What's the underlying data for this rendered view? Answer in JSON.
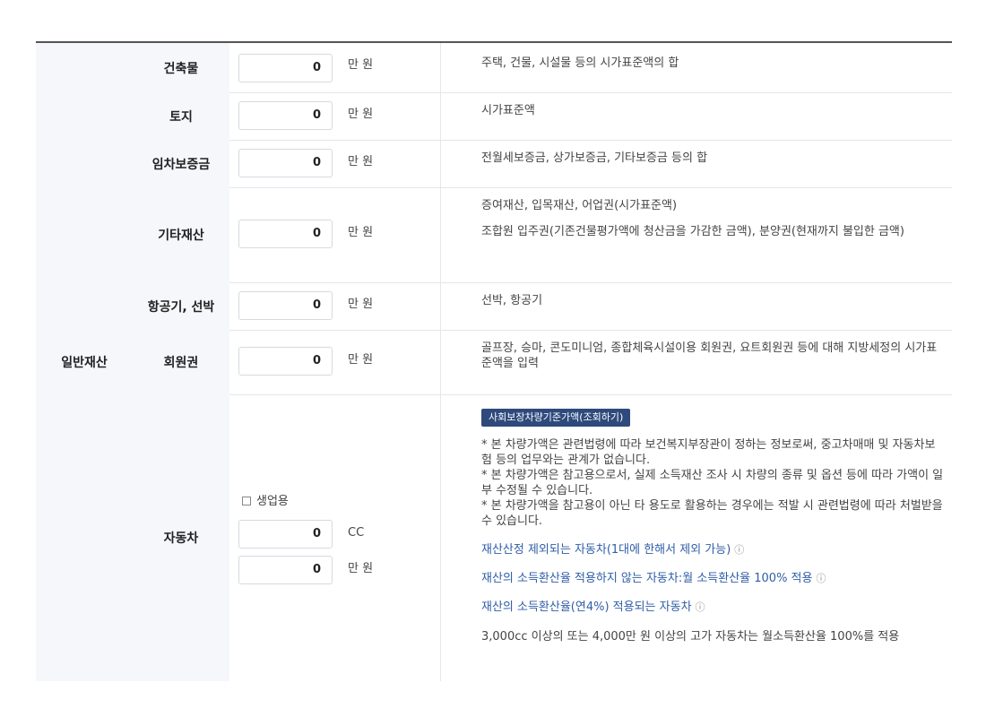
{
  "category": "일반재산",
  "rows": [
    {
      "label": "건축물",
      "value": "0",
      "unit": "만 원",
      "desc": "주택, 건물, 시설물 등의 시가표준액의 합"
    },
    {
      "label": "토지",
      "value": "0",
      "unit": "만 원",
      "desc": "시가표준액"
    },
    {
      "label": "임차보증금",
      "value": "0",
      "unit": "만 원",
      "desc": "전월세보증금, 상가보증금, 기타보증금 등의 합"
    },
    {
      "label": "기타재산",
      "value": "0",
      "unit": "만 원",
      "desc1": "증여재산, 입목재산, 어업권(시가표준액)",
      "desc2": "조합원 입주권(기존건물평가액에 청산금을 가감한 금액), 분양권(현재까지 불입한 금액)"
    },
    {
      "label": "항공기, 선박",
      "value": "0",
      "unit": "만 원",
      "desc": "선박, 항공기"
    },
    {
      "label": "회원권",
      "value": "0",
      "unit": "만 원",
      "desc": "골프장, 승마, 콘도미니엄, 종합체육시설이용 회원권, 요트회원권 등에 대해 지방세정의 시가표준액을 입력"
    }
  ],
  "car": {
    "label": "자동차",
    "checkbox_label": "생업용",
    "cc_value": "0",
    "cc_unit": "CC",
    "price_value": "0",
    "price_unit": "만 원",
    "badge": "사회보장차량기준가액(조회하기)",
    "notes": [
      "* 본 차량가액은 관련법령에 따라 보건복지부장관이 정하는 정보로써, 중고차매매 및 자동차보험 등의 업무와는 관계가 없습니다.",
      "* 본 차량가액은 참고용으로서, 실제 소득재산 조사 시 차량의 종류 및 옵션 등에 따라 가액이 일부 수정될 수 있습니다.",
      "* 본 차량가액을 참고용이 아닌 타 용도로 활용하는 경우에는 적발 시 관련법령에 따라 처벌받을 수 있습니다."
    ],
    "links": [
      "재산산정 제외되는 자동차(1대에 한해서 제외 가능)",
      "재산의 소득환산율 적용하지 않는 자동차:월 소득환산율 100% 적용",
      "재산의 소득환산율(연4%) 적용되는 자동차"
    ],
    "footnote": "3,000cc 이상의 또는 4,000만 원 이상의 고가 자동차는 월소득환산율 100%를 적용"
  }
}
